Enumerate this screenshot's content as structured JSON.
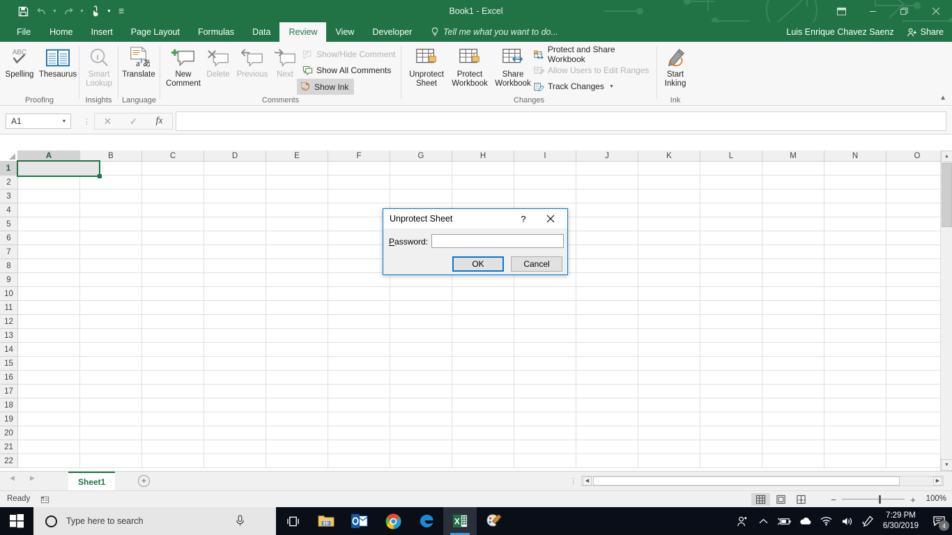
{
  "window": {
    "title": "Book1 - Excel",
    "user_name": "Luis Enrique Chavez Saenz",
    "share_label": "Share",
    "quick_access": [
      {
        "name": "save-icon",
        "label": "Save"
      },
      {
        "name": "undo-icon",
        "label": "Undo"
      },
      {
        "name": "redo-icon",
        "label": "Redo"
      },
      {
        "name": "touch-mode-icon",
        "label": "Touch/Mouse Mode"
      },
      {
        "name": "customize-qat-icon",
        "label": "Customize Quick Access Toolbar"
      }
    ],
    "buttons": [
      {
        "name": "ribbon-display-options",
        "label": "Ribbon Display Options"
      },
      {
        "name": "minimize-button",
        "label": "Minimize"
      },
      {
        "name": "restore-button",
        "label": "Restore Down"
      },
      {
        "name": "close-button",
        "label": "Close"
      }
    ]
  },
  "ribbon": {
    "tabs": [
      {
        "label": "File",
        "active": false
      },
      {
        "label": "Home",
        "active": false
      },
      {
        "label": "Insert",
        "active": false
      },
      {
        "label": "Page Layout",
        "active": false
      },
      {
        "label": "Formulas",
        "active": false
      },
      {
        "label": "Data",
        "active": false
      },
      {
        "label": "Review",
        "active": true
      },
      {
        "label": "View",
        "active": false
      },
      {
        "label": "Developer",
        "active": false
      }
    ],
    "tell_me": "Tell me what you want to do...",
    "groups": [
      {
        "name": "Proofing",
        "buttons": [
          {
            "label_line1": "Spelling",
            "label_line2": "",
            "icon": "spelling-abc-check-icon",
            "disabled": false
          },
          {
            "label_line1": "Thesaurus",
            "label_line2": "",
            "icon": "thesaurus-book-icon",
            "disabled": false
          }
        ]
      },
      {
        "name": "Insights",
        "buttons": [
          {
            "label_line1": "Smart",
            "label_line2": "Lookup",
            "icon": "smart-lookup-magnifier-icon",
            "disabled": true
          }
        ]
      },
      {
        "name": "Language",
        "buttons": [
          {
            "label_line1": "Translate",
            "label_line2": "",
            "icon": "translate-icon",
            "disabled": false
          }
        ]
      },
      {
        "name": "Comments",
        "buttons": [
          {
            "label_line1": "New",
            "label_line2": "Comment",
            "icon": "new-comment-icon",
            "disabled": false
          },
          {
            "label_line1": "Delete",
            "label_line2": "",
            "icon": "delete-comment-icon",
            "disabled": true
          },
          {
            "label_line1": "Previous",
            "label_line2": "",
            "icon": "previous-comment-icon",
            "disabled": true
          },
          {
            "label_line1": "Next",
            "label_line2": "",
            "icon": "next-comment-icon",
            "disabled": true
          }
        ],
        "small_buttons": [
          {
            "label": "Show/Hide Comment",
            "icon": "show-hide-comment-icon",
            "disabled": true,
            "toggled": false
          },
          {
            "label": "Show All Comments",
            "icon": "show-all-comments-icon",
            "disabled": false,
            "toggled": false
          },
          {
            "label": "Show Ink",
            "icon": "show-ink-icon",
            "disabled": false,
            "toggled": true
          }
        ]
      },
      {
        "name": "Changes",
        "buttons": [
          {
            "label_line1": "Unprotect",
            "label_line2": "Sheet",
            "icon": "unprotect-sheet-icon",
            "disabled": false
          },
          {
            "label_line1": "Protect",
            "label_line2": "Workbook",
            "icon": "protect-workbook-icon",
            "disabled": false
          },
          {
            "label_line1": "Share",
            "label_line2": "Workbook",
            "icon": "share-workbook-icon",
            "disabled": false
          }
        ],
        "small_buttons": [
          {
            "label": "Protect and Share Workbook",
            "icon": "protect-share-workbook-icon",
            "disabled": false,
            "toggled": false
          },
          {
            "label": "Allow Users to Edit Ranges",
            "icon": "allow-users-edit-ranges-icon",
            "disabled": true,
            "toggled": false
          },
          {
            "label": "Track Changes",
            "icon": "track-changes-icon",
            "disabled": false,
            "toggled": false,
            "dropdown": true
          }
        ]
      },
      {
        "name": "Ink",
        "buttons": [
          {
            "label_line1": "Start",
            "label_line2": "Inking",
            "icon": "start-inking-pen-icon",
            "disabled": false
          }
        ]
      }
    ],
    "collapse_label": "Collapse the Ribbon"
  },
  "formula_bar": {
    "name_box_value": "A1",
    "cancel_label": "Cancel",
    "enter_label": "Enter",
    "insert_function_label": "fx",
    "formula_value": ""
  },
  "grid": {
    "columns": [
      "A",
      "B",
      "C",
      "D",
      "E",
      "F",
      "G",
      "H",
      "I",
      "J",
      "K",
      "L",
      "M",
      "N",
      "O"
    ],
    "rows": [
      1,
      2,
      3,
      4,
      5,
      6,
      7,
      8,
      9,
      10,
      11,
      12,
      13,
      14,
      15,
      16,
      17,
      18,
      19,
      20,
      21,
      22
    ],
    "selected_cell": "A1",
    "selected_column": "A",
    "selected_row": 1
  },
  "sheet_tabs": {
    "tabs": [
      {
        "label": "Sheet1",
        "active": true
      }
    ],
    "add_sheet_label": "+",
    "prev_label": "Previous Sheet",
    "next_label": "Next Sheet"
  },
  "status_bar": {
    "mode": "Ready",
    "macro_record_label": "Record Macro",
    "views": [
      {
        "name": "normal-view-icon",
        "label": "Normal",
        "active": true
      },
      {
        "name": "page-layout-view-icon",
        "label": "Page Layout",
        "active": false
      },
      {
        "name": "page-break-preview-icon",
        "label": "Page Break Preview",
        "active": false
      }
    ],
    "zoom_out_label": "−",
    "zoom_in_label": "+",
    "zoom_percent": "100%"
  },
  "dialog": {
    "title": "Unprotect Sheet",
    "help_label": "?",
    "close_label": "✕",
    "password_label_pre": "P",
    "password_label_post": "assword:",
    "password_value": "",
    "ok_label": "OK",
    "cancel_label": "Cancel"
  },
  "taskbar": {
    "start_label": "Start",
    "search_placeholder": "Type here to search",
    "search_value": "",
    "mic_label": "Cortana microphone",
    "task_view_label": "Task View",
    "apps": [
      {
        "name": "file-explorer-icon",
        "label": "File Explorer",
        "active": false,
        "running": false
      },
      {
        "name": "outlook-icon",
        "label": "Outlook",
        "active": false,
        "running": false
      },
      {
        "name": "chrome-icon",
        "label": "Google Chrome",
        "active": false,
        "running": true
      },
      {
        "name": "edge-icon",
        "label": "Microsoft Edge",
        "active": false,
        "running": false
      },
      {
        "name": "excel-icon",
        "label": "Excel",
        "active": true,
        "running": true
      },
      {
        "name": "paint-icon",
        "label": "Paint 3D",
        "active": false,
        "running": false
      }
    ],
    "tray": [
      {
        "name": "people-icon",
        "label": "People"
      },
      {
        "name": "chevron-up-icon",
        "label": "Show hidden icons"
      },
      {
        "name": "battery-icon",
        "label": "Battery"
      },
      {
        "name": "onedrive-cloud-icon",
        "label": "OneDrive"
      },
      {
        "name": "wifi-icon",
        "label": "Network"
      },
      {
        "name": "volume-icon",
        "label": "Volume"
      },
      {
        "name": "pen-workspace-icon",
        "label": "Windows Ink Workspace"
      }
    ],
    "clock_time": "7:29 PM",
    "clock_date": "6/30/2019",
    "notification_count": "4"
  },
  "colors": {
    "excel_green": "#217346",
    "ribbon_bg": "#f7f7f7",
    "accent_blue": "#0078d7"
  }
}
